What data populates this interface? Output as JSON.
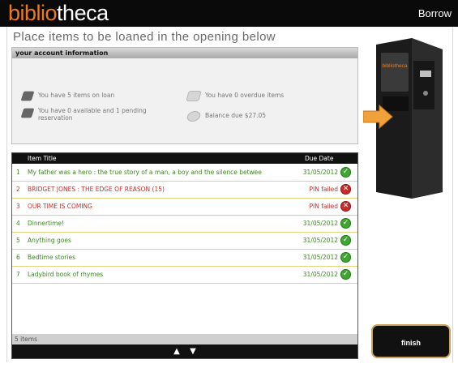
{
  "header": {
    "logo_part1": "biblio",
    "logo_part2": "theca",
    "mode": "Borrow"
  },
  "page": {
    "heading": "Place items to be loaned in the opening below"
  },
  "account": {
    "title": "your account information",
    "on_loan": "You have 5 items on loan",
    "overdue": "You have 0 overdue items",
    "reservation_line1": "You have 0 available and 1 pending",
    "reservation_line2": "reservation",
    "balance": "Balance due $27.05"
  },
  "table": {
    "col_title": "Item Title",
    "col_due": "Due Date",
    "rows": [
      {
        "num": "1",
        "title": "My father was a hero : the true story of a man, a boy and the silence betwee",
        "due": "31/05/2012",
        "status": "ok"
      },
      {
        "num": "2",
        "title": "BRIDGET JONES : THE EDGE OF REASON (15)",
        "due": "PIN failed",
        "status": "fail"
      },
      {
        "num": "3",
        "title": "OUR TIME IS COMING",
        "due": "PIN failed",
        "status": "fail"
      },
      {
        "num": "4",
        "title": "Dinnertime!",
        "due": "31/05/2012",
        "status": "ok"
      },
      {
        "num": "5",
        "title": "Anything goes",
        "due": "31/05/2012",
        "status": "ok"
      },
      {
        "num": "6",
        "title": "Bedtime stories",
        "due": "31/05/2012",
        "status": "ok"
      },
      {
        "num": "7",
        "title": "Ladybird book of rhymes",
        "due": "31/05/2012",
        "status": "ok"
      }
    ],
    "count": "5 items"
  },
  "kiosk": {
    "brand": "bibliotheca"
  },
  "actions": {
    "finish": "finish"
  },
  "colors": {
    "brand_orange": "#ec7a18",
    "ok_green": "#41a531",
    "fail_red": "#c92b2b"
  }
}
